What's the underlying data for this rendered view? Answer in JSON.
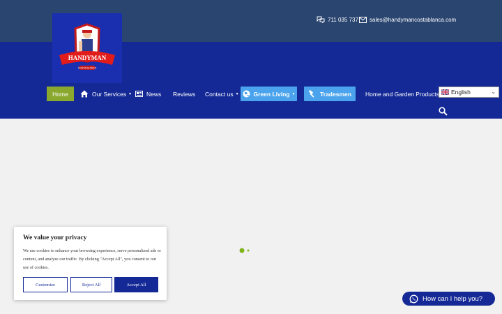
{
  "header": {
    "logo_text": "HANDYMAN",
    "logo_subtext": "COSTA BLANCA",
    "phone": "711 035 737",
    "email": "sales@handymancostablanca.com"
  },
  "nav": {
    "home": "Home",
    "our_services": "Our Services",
    "news": "News",
    "reviews": "Reviews",
    "contact_us": "Contact us",
    "green_living": "Green Living",
    "tradesmen": "Tradesmen",
    "home_garden": "Home and Garden Products"
  },
  "language": {
    "selected": "English"
  },
  "cookie": {
    "title": "We value your privacy",
    "text": "We use cookies to enhance your browsing experience, serve personalized ads or content, and analyze our traffic. By clicking \"Accept All\", you consent to our use of cookies.",
    "customize": "Customize",
    "reject": "Reject All",
    "accept": "Accept All"
  },
  "chat": {
    "label": "How can I help you?"
  },
  "colors": {
    "topbar": "#2a4570",
    "header": "#142996",
    "home_active": "#8aa82e",
    "pill": "#4aa3ec",
    "loader": "#7fb51a"
  },
  "icons": [
    "chat-bubbles-icon",
    "mail-icon",
    "house-icon",
    "newspaper-icon",
    "globe-leaf-icon",
    "hammer-icon",
    "search-icon",
    "whatsapp-icon",
    "chevron-down-icon"
  ]
}
